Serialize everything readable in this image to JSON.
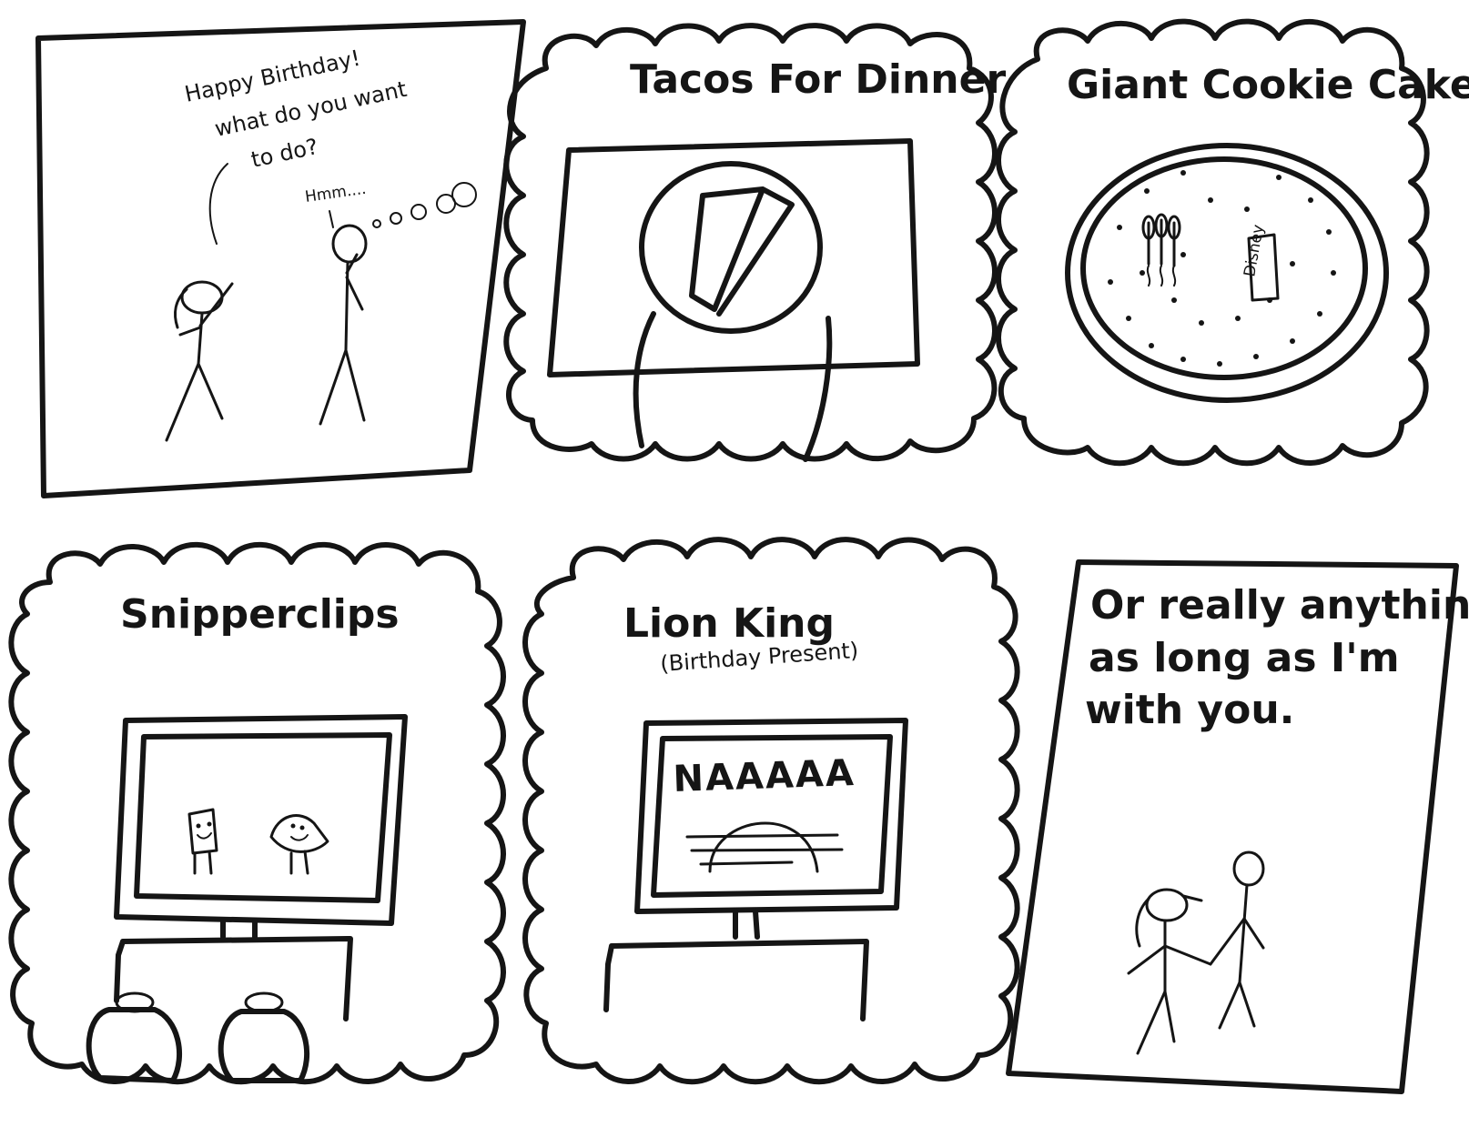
{
  "panel1": {
    "speech_line1": "Happy Birthday!",
    "speech_line2": "what do you want",
    "speech_line3": "to do?",
    "thought": "Hmm...."
  },
  "panel2": {
    "caption": "Tacos For Dinner"
  },
  "panel3": {
    "caption": "Giant Cookie Cake",
    "cake_sign": "Disney"
  },
  "panel4": {
    "caption": "Snipperclips"
  },
  "panel5": {
    "caption": "Lion King",
    "subcaption": "(Birthday Present)",
    "tv_text": "NAAAAA"
  },
  "panel6": {
    "line1": "Or really anything",
    "line2": "as long as I'm",
    "line3": "with you."
  },
  "colors": {
    "ink": "#151515",
    "paper": "#ffffff"
  }
}
